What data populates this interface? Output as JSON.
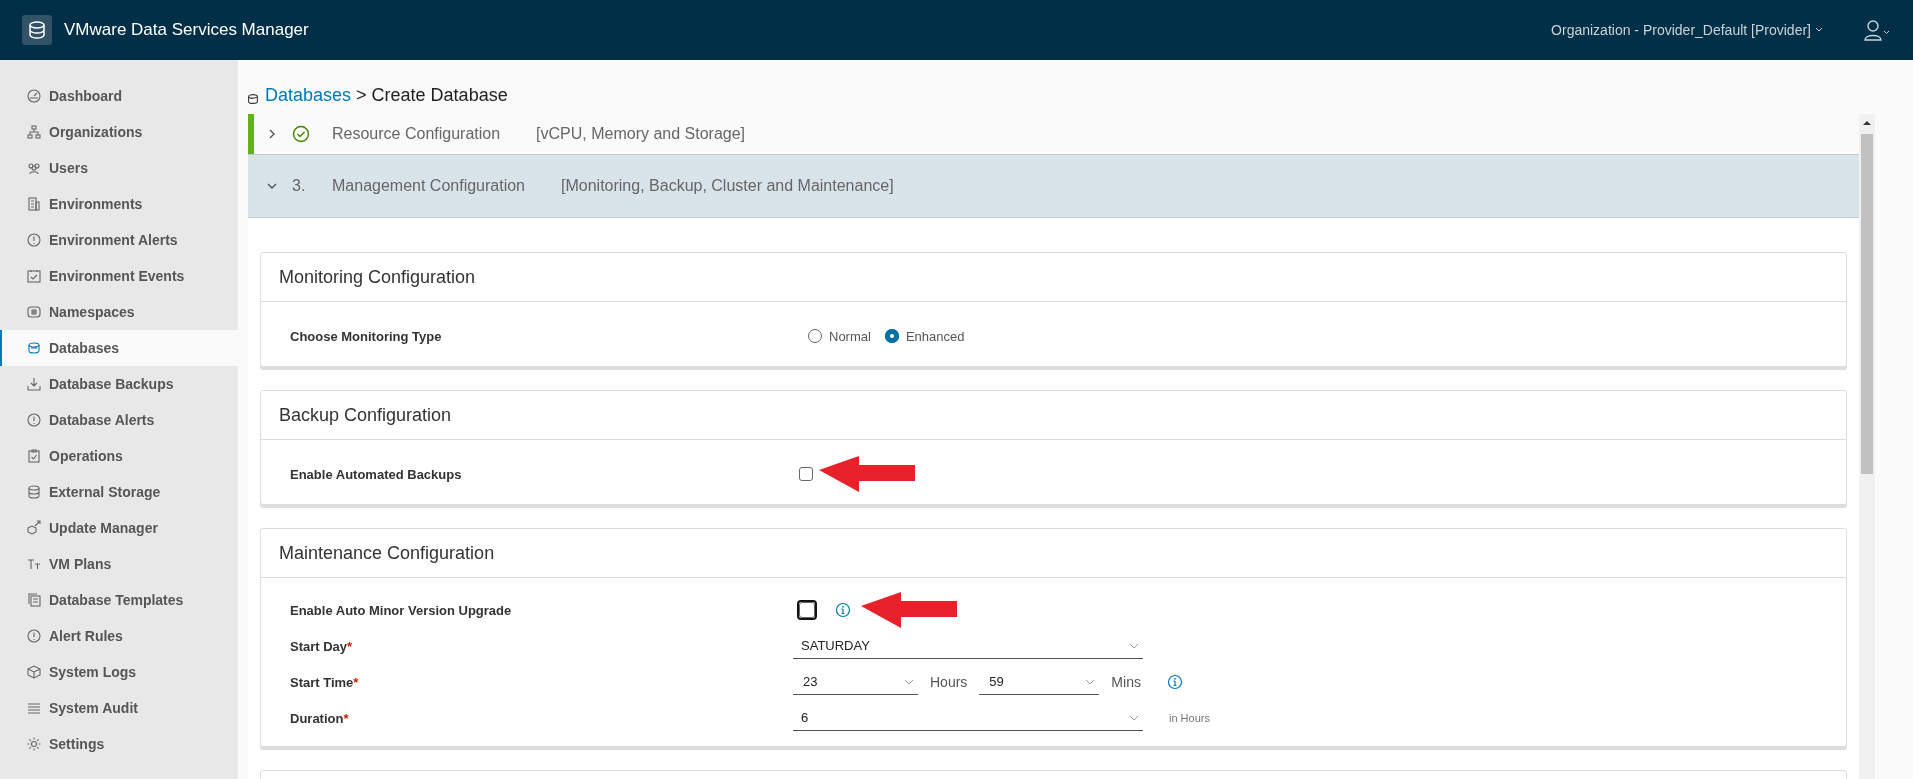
{
  "header": {
    "title": "VMware Data Services Manager",
    "org": "Organization - Provider_Default [Provider]"
  },
  "sidebar": {
    "items": [
      {
        "label": "Dashboard",
        "selected": false
      },
      {
        "label": "Organizations",
        "selected": false
      },
      {
        "label": "Users",
        "selected": false
      },
      {
        "label": "Environments",
        "selected": false
      },
      {
        "label": "Environment Alerts",
        "selected": false
      },
      {
        "label": "Environment Events",
        "selected": false
      },
      {
        "label": "Namespaces",
        "selected": false
      },
      {
        "label": "Databases",
        "selected": true
      },
      {
        "label": "Database Backups",
        "selected": false
      },
      {
        "label": "Database Alerts",
        "selected": false
      },
      {
        "label": "Operations",
        "selected": false
      },
      {
        "label": "External Storage",
        "selected": false
      },
      {
        "label": "Update Manager",
        "selected": false
      },
      {
        "label": "VM Plans",
        "selected": false
      },
      {
        "label": "Database Templates",
        "selected": false
      },
      {
        "label": "Alert Rules",
        "selected": false
      },
      {
        "label": "System Logs",
        "selected": false
      },
      {
        "label": "System Audit",
        "selected": false
      },
      {
        "label": "Settings",
        "selected": false
      }
    ]
  },
  "breadcrumb": {
    "link": "Databases",
    "separator": ">",
    "current": "Create Database"
  },
  "steps": [
    {
      "kind": "done",
      "title": "Resource Configuration",
      "subtitle": "[vCPU, Memory and Storage]",
      "expanded": false
    },
    {
      "kind": "numbered",
      "number": "3.",
      "title": "Management Configuration",
      "subtitle": "[Monitoring, Backup, Cluster and Maintenance]",
      "expanded": true
    }
  ],
  "monitoring": {
    "title": "Monitoring Configuration",
    "label": "Choose Monitoring Type",
    "options": [
      {
        "label": "Normal",
        "selected": false
      },
      {
        "label": "Enhanced",
        "selected": true
      }
    ]
  },
  "backup": {
    "title": "Backup Configuration",
    "label": "Enable Automated Backups",
    "checked": false
  },
  "maintenance": {
    "title": "Maintenance Configuration",
    "auto_upgrade": {
      "label": "Enable Auto Minor Version Upgrade",
      "checked": false,
      "focused": true
    },
    "start_day": {
      "label": "Start Day",
      "required_mark": "*",
      "value": "SATURDAY"
    },
    "start_time": {
      "label": "Start Time",
      "required_mark": "*",
      "hours": "23",
      "hours_unit": "Hours",
      "mins": "59",
      "mins_unit": "Mins"
    },
    "duration": {
      "label": "Duration",
      "required_mark": "*",
      "value": "6",
      "unit": "in Hours"
    }
  }
}
